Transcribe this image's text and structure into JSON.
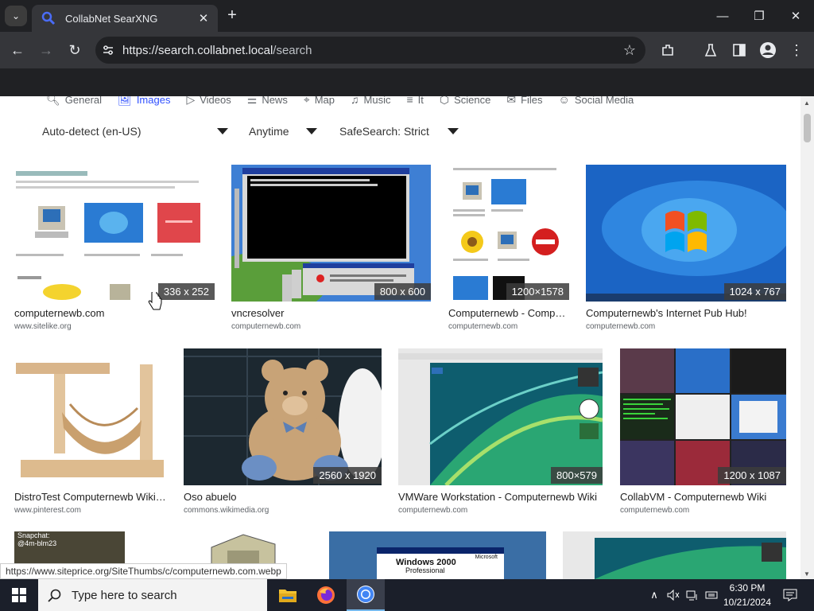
{
  "browser": {
    "tab_title": "CollabNet SearXNG",
    "url_host": "https://search.collabnet.local",
    "url_path": "/search"
  },
  "categories": [
    {
      "label": "General",
      "icon": "search-icon",
      "active": false
    },
    {
      "label": "Images",
      "icon": "image-icon",
      "active": true
    },
    {
      "label": "Videos",
      "icon": "play-icon",
      "active": false
    },
    {
      "label": "News",
      "icon": "newspaper-icon",
      "active": false
    },
    {
      "label": "Map",
      "icon": "map-pin-icon",
      "active": false
    },
    {
      "label": "Music",
      "icon": "music-note-icon",
      "active": false
    },
    {
      "label": "It",
      "icon": "layers-icon",
      "active": false
    },
    {
      "label": "Science",
      "icon": "cube-icon",
      "active": false
    },
    {
      "label": "Files",
      "icon": "mail-icon",
      "active": false
    },
    {
      "label": "Social Media",
      "icon": "people-icon",
      "active": false
    }
  ],
  "filters": {
    "language": "Auto-detect (en-US)",
    "time": "Anytime",
    "safesearch": "SafeSearch: Strict"
  },
  "results": [
    {
      "title": "computernewb.com",
      "source": "www.sitelike.org",
      "size": "336 x 252"
    },
    {
      "title": "vncresolver",
      "source": "computernewb.com",
      "size": "800 x 600"
    },
    {
      "title": "Computernewb - Comp…",
      "source": "computernewb.com",
      "size": "1200×1578"
    },
    {
      "title": "Computernewb's Internet Pub Hub!",
      "source": "computernewb.com",
      "size": "1024 x 767"
    },
    {
      "title": "DistroTest Computernewb Wiki…",
      "source": "www.pinterest.com",
      "size": ""
    },
    {
      "title": "Oso abuelo",
      "source": "commons.wikimedia.org",
      "size": "2560 x 1920"
    },
    {
      "title": "VMWare Workstation - Computernewb Wiki",
      "source": "computernewb.com",
      "size": "800×579"
    },
    {
      "title": "CollabVM - Computernewb Wiki",
      "source": "computernewb.com",
      "size": "1200 x 1087"
    }
  ],
  "row3_thumbs": {
    "snapchat_line1": "Snapchat:",
    "snapchat_line2": "@4m-blm23",
    "win2000_line1": "Windows 2000",
    "win2000_line2": "Professional",
    "win2000_brand": "Microsoft"
  },
  "status_url": "https://www.siteprice.org/SiteThumbs/c/computernewb.com.webp",
  "taskbar": {
    "search_placeholder": "Type here to search",
    "time": "6:30 PM",
    "date": "10/21/2024"
  },
  "colors": {
    "accent": "#3050ff",
    "taskbar": "#1b1f2a",
    "chrome_dark": "#202124"
  }
}
